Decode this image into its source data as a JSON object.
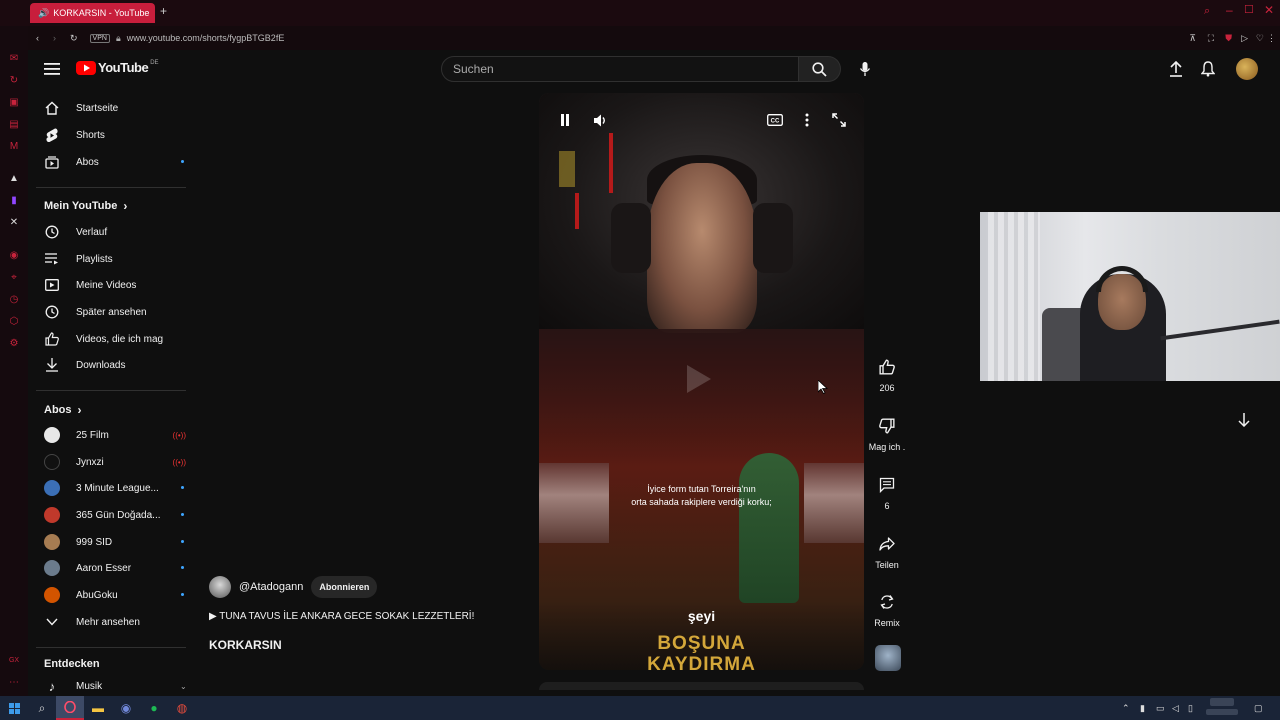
{
  "browser": {
    "tab_title": "KORKARSIN - YouTube",
    "url": "www.youtube.com/shorts/fygpBTGB2fE",
    "vpn_label": "VPN"
  },
  "header": {
    "logo_text": "YouTube",
    "logo_region": "DE",
    "search_placeholder": "Suchen"
  },
  "sidebar": {
    "primary": [
      {
        "label": "Startseite",
        "icon": "home-icon"
      },
      {
        "label": "Shorts",
        "icon": "shorts-icon"
      },
      {
        "label": "Abos",
        "icon": "subscriptions-icon"
      }
    ],
    "you_title": "Mein YouTube",
    "you_items": [
      {
        "label": "Verlauf",
        "icon": "history-icon"
      },
      {
        "label": "Playlists",
        "icon": "playlists-icon"
      },
      {
        "label": "Meine Videos",
        "icon": "my-videos-icon"
      },
      {
        "label": "Später ansehen",
        "icon": "watch-later-icon"
      },
      {
        "label": "Videos, die ich mag",
        "icon": "liked-videos-icon"
      },
      {
        "label": "Downloads",
        "icon": "downloads-icon"
      }
    ],
    "subs_title": "Abos",
    "subs": [
      {
        "label": "25 Film",
        "status": "live",
        "color": "#e8e8e8"
      },
      {
        "label": "Jynxzi",
        "status": "live",
        "color": "#111111"
      },
      {
        "label": "3 Minute League...",
        "status": "new",
        "color": "#3b6fb6"
      },
      {
        "label": "365 Gün Doğada...",
        "status": "new",
        "color": "#c0392b"
      },
      {
        "label": "999 SID",
        "status": "new",
        "color": "#a67c52"
      },
      {
        "label": "Aaron Esser",
        "status": "new",
        "color": "#6b7b8c"
      },
      {
        "label": "AbuGoku",
        "status": "new",
        "color": "#d35400"
      }
    ],
    "show_more": "Mehr ansehen",
    "explore_title": "Entdecken",
    "explore_items": [
      {
        "label": "Musik",
        "icon": "music-icon"
      }
    ]
  },
  "short": {
    "channel": "@Atadogann",
    "subscribe_label": "Abonnieren",
    "description": "▶ TUNA TAVUS İLE ANKARA GECE SOKAK LEZZETLERİ!",
    "title": "KORKARSIN",
    "subtitle_line1": "İyice form tutan Torreira'nın",
    "subtitle_line2": "orta sahada rakiplere verdiği korku;",
    "caption_small": "şeyi",
    "caption_big1": "BOŞUNA",
    "caption_big2": "KAYDIRMA"
  },
  "actions": {
    "like_count": "206",
    "dislike_label": "Mag ich .",
    "comment_count": "6",
    "share_label": "Teilen",
    "remix_label": "Remix"
  },
  "colors": {
    "accent": "#ff0000",
    "opera": "#c8233c",
    "background": "#0f0f0f",
    "caption_gold": "#d4a73a",
    "live_dot": "#3ea6ff"
  }
}
